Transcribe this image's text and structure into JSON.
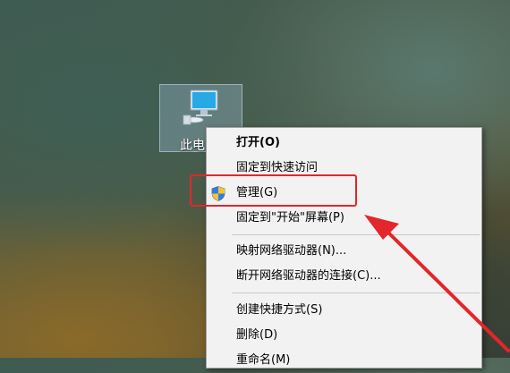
{
  "desktop": {
    "icon_label": "此电",
    "icon_name": "computer-icon"
  },
  "context_menu": {
    "items": [
      {
        "label": "打开(O)",
        "bold": true
      },
      {
        "label": "固定到快速访问"
      },
      {
        "label": "管理(G)",
        "icon": "uac-shield-icon"
      },
      {
        "label": "固定到\"开始\"屏幕(P)"
      },
      {
        "label": "映射网络驱动器(N)..."
      },
      {
        "label": "断开网络驱动器的连接(C)..."
      },
      {
        "label": "创建快捷方式(S)"
      },
      {
        "label": "删除(D)"
      },
      {
        "label": "重命名(M)"
      }
    ]
  },
  "annotation": {
    "highlight_color": "#e3262b",
    "arrow_color": "#e3262b"
  }
}
